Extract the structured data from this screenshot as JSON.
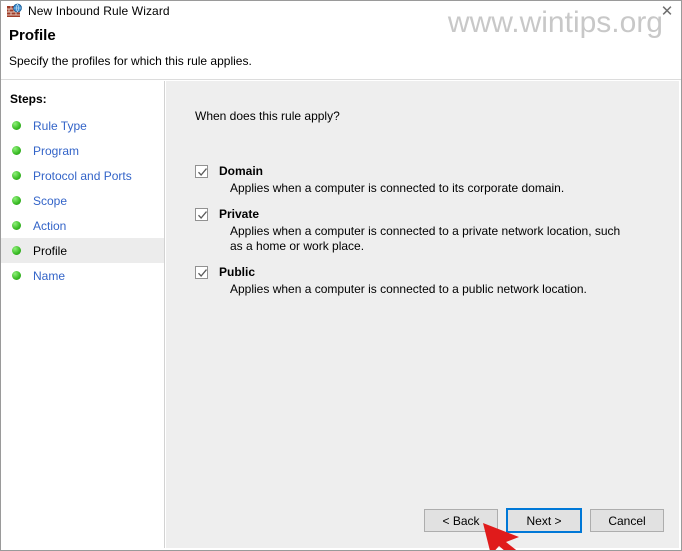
{
  "window": {
    "title": "New Inbound Rule Wizard",
    "icon": "firewall-icon",
    "close_label": "✕"
  },
  "watermark": {
    "text": "www.wintips.org",
    "color": "#c8c8c8"
  },
  "header": {
    "title": "Profile",
    "subtitle": "Specify the profiles for which this rule applies."
  },
  "sidebar": {
    "heading": "Steps:",
    "items": [
      {
        "label": "Rule Type",
        "current": false
      },
      {
        "label": "Program",
        "current": false
      },
      {
        "label": "Protocol and Ports",
        "current": false
      },
      {
        "label": "Scope",
        "current": false
      },
      {
        "label": "Action",
        "current": false
      },
      {
        "label": "Profile",
        "current": true
      },
      {
        "label": "Name",
        "current": false
      }
    ],
    "bullet_color": "#3fbf2a",
    "link_color": "#3364c8"
  },
  "main": {
    "question": "When does this rule apply?",
    "options": [
      {
        "name": "Domain",
        "checked": true,
        "description": "Applies when a computer is connected to its corporate domain."
      },
      {
        "name": "Private",
        "checked": true,
        "description": "Applies when a computer is connected to a private network location, such as a home or work place."
      },
      {
        "name": "Public",
        "checked": true,
        "description": "Applies when a computer is connected to a public network location."
      }
    ]
  },
  "footer": {
    "back_label": "< Back",
    "next_label": "Next >",
    "cancel_label": "Cancel",
    "focused_button": "Next >",
    "focus_color": "#0078d7"
  },
  "annotation": {
    "arrow_color": "#e01b1b",
    "points_at": "Next >"
  }
}
